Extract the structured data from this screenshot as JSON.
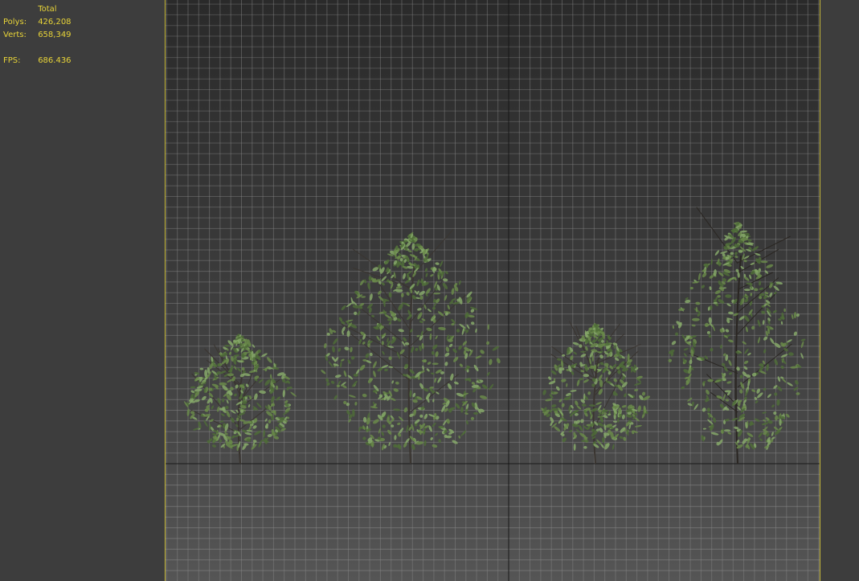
{
  "stats": {
    "header": "Total",
    "polys_label": "Polys:",
    "polys_value": "426,208",
    "verts_label": "Verts:",
    "verts_value": "658,349",
    "fps_label": "FPS:",
    "fps_value": "686.436"
  },
  "colors": {
    "stats_text": "#e8d438",
    "viewport_border": "#c8b93a",
    "foliage": "#6a8a4a",
    "grid": "#8a8a8a",
    "axis": "#111111"
  }
}
